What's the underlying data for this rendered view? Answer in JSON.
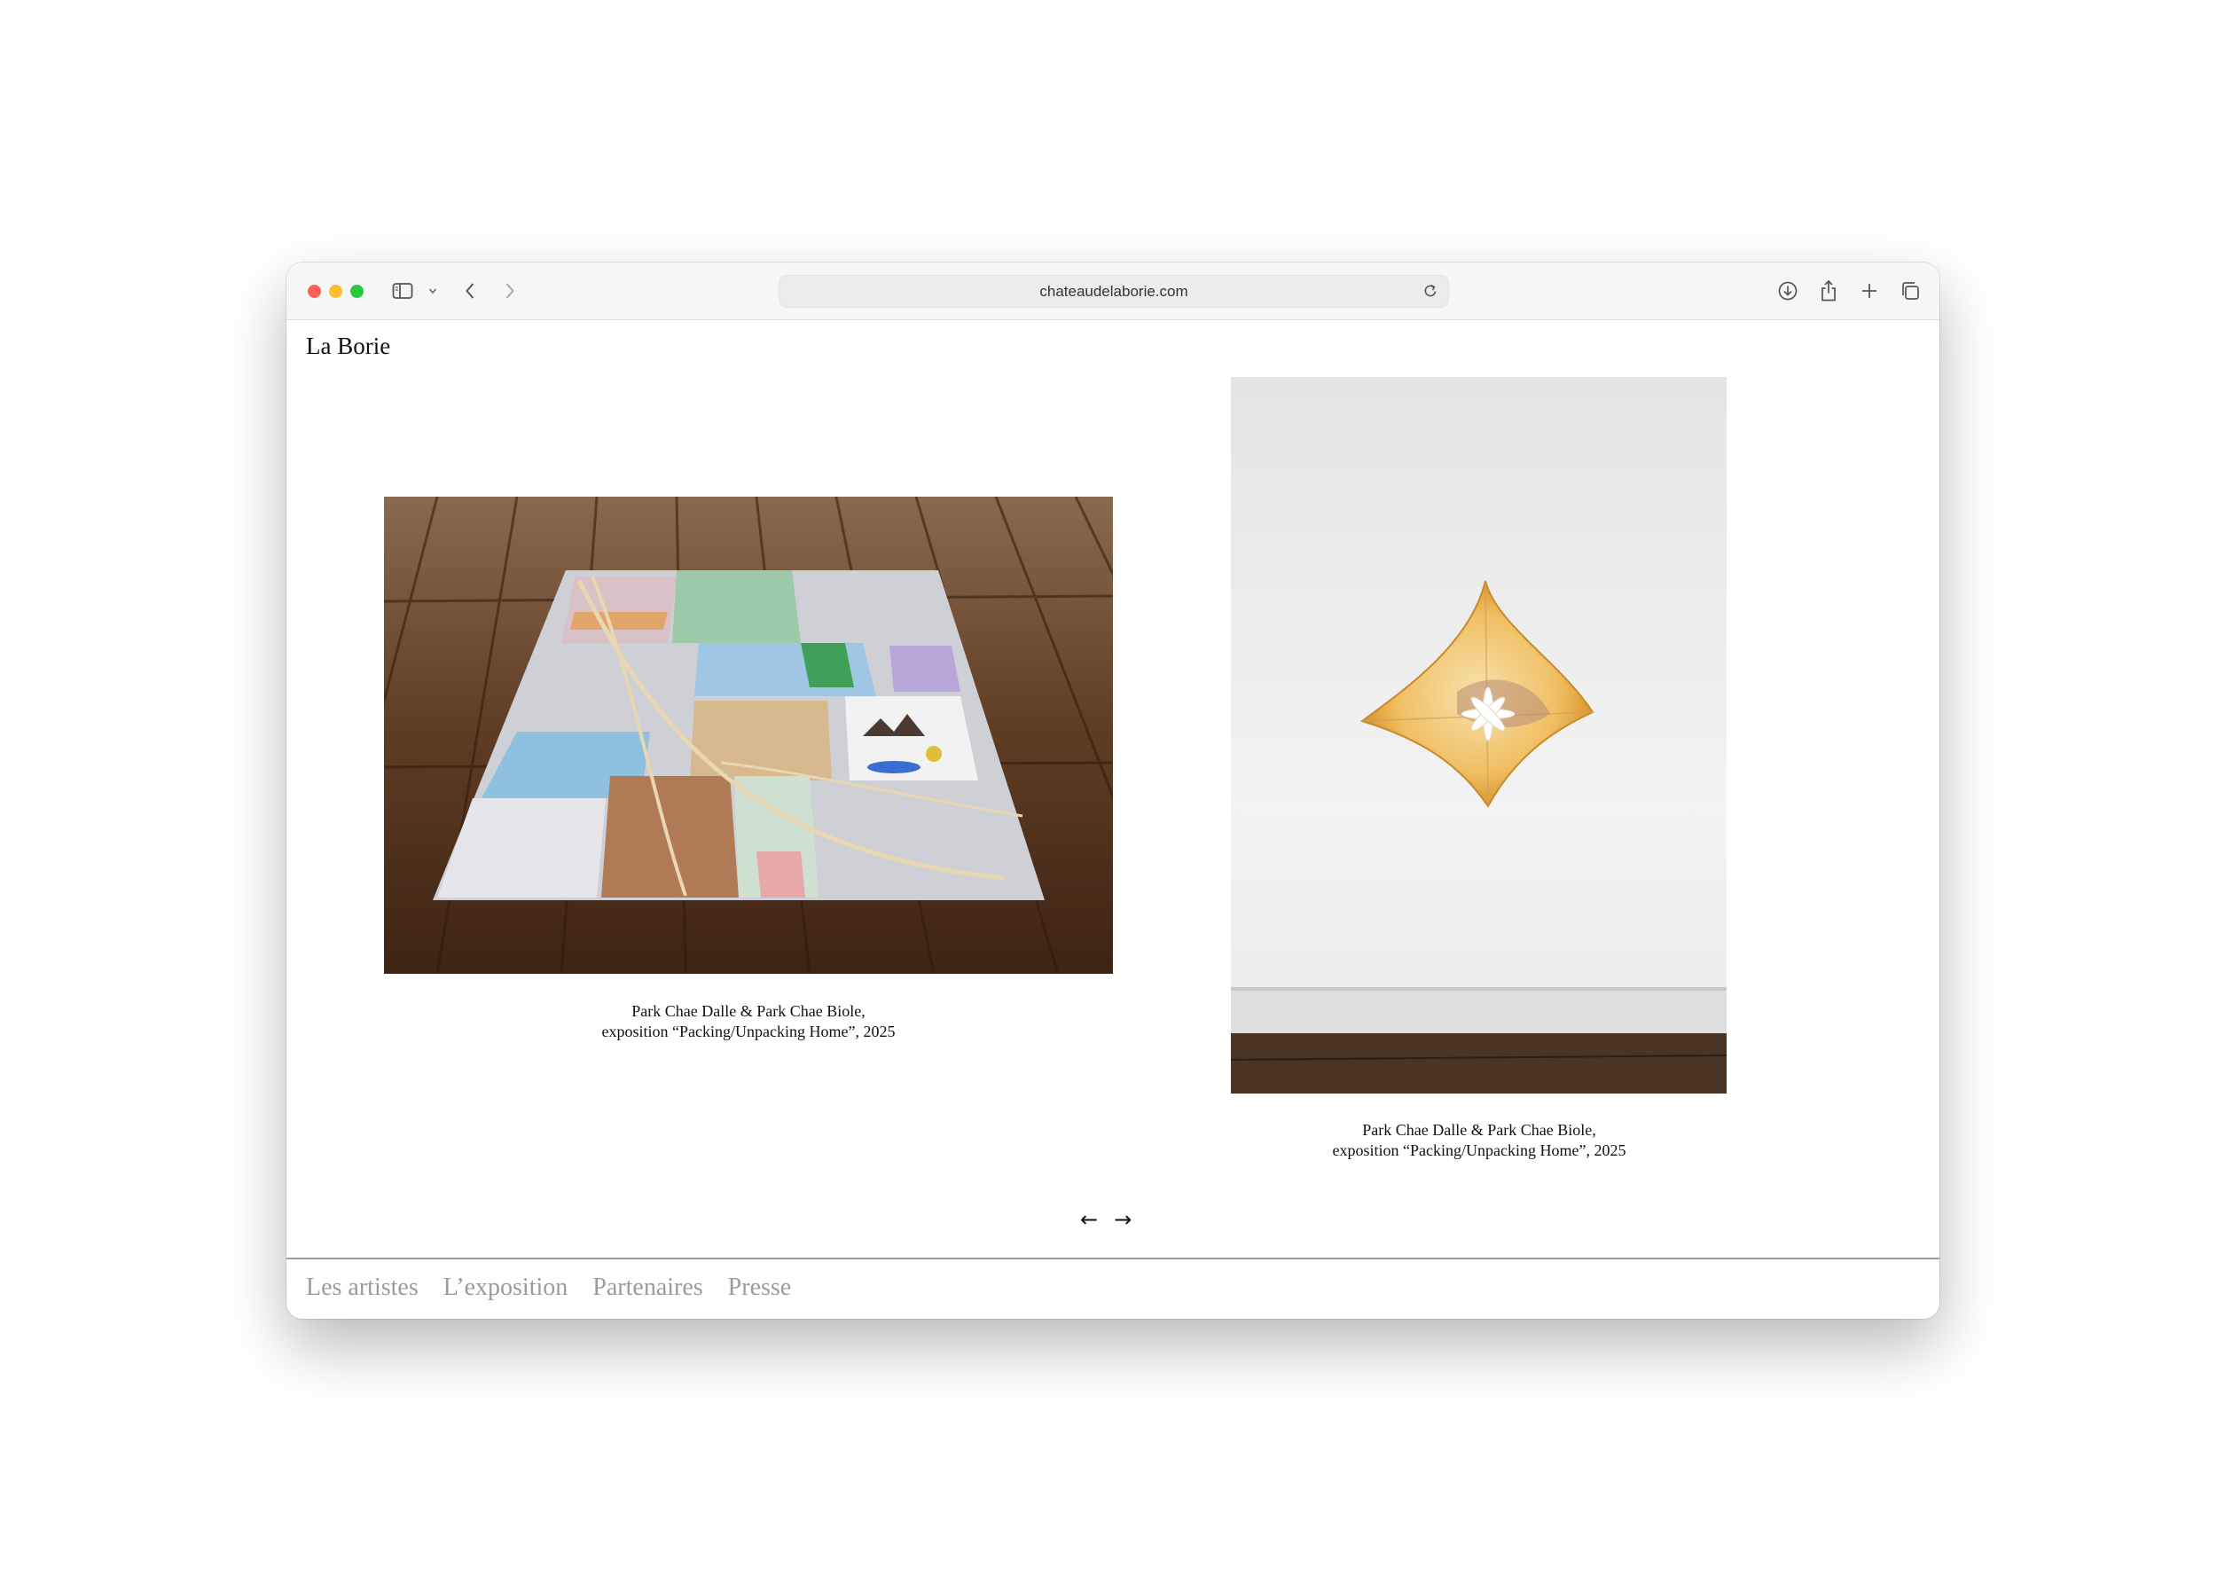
{
  "browser": {
    "url": "chateaudelaborie.com",
    "icons": {
      "sidebar": "sidebar-icon",
      "back": "chevron-left-icon",
      "forward": "chevron-right-icon",
      "reload": "reload-icon",
      "download": "download-icon",
      "share": "share-icon",
      "new_tab": "plus-icon",
      "tabs": "tabs-overview-icon"
    }
  },
  "site": {
    "title": "La Borie"
  },
  "gallery": {
    "items": [
      {
        "caption_line1": "Park Chae Dalle & Park Chae Biole,",
        "caption_line2": "exposition “Packing/Unpacking Home”, 2025"
      },
      {
        "caption_line1": "Park Chae Dalle & Park Chae Biole,",
        "caption_line2": "exposition “Packing/Unpacking Home”, 2025"
      }
    ],
    "prev_label": "←",
    "next_label": "→"
  },
  "footer": {
    "links": [
      "Les artistes",
      "L’exposition",
      "Partenaires",
      "Presse"
    ]
  }
}
